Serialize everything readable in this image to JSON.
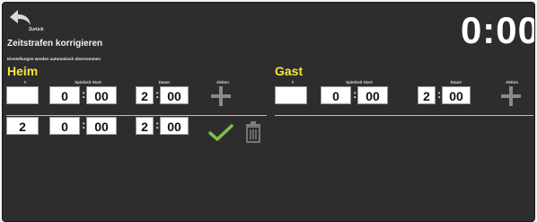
{
  "header": {
    "back_label": "Zurück",
    "title": "Zeitstrafen korrigieren",
    "subtitle": "Einstellungen werden automatisch übernommen",
    "clock": "0:00"
  },
  "home": {
    "name": "Heim",
    "columns": {
      "number": "#",
      "start": "Spielzeit Start",
      "duration": "Dauer",
      "action": "Aktion"
    },
    "new_entry": {
      "number": "",
      "start_min": "0",
      "start_sec": "00",
      "dur_min": "2",
      "dur_sec": "00"
    },
    "penalties": [
      {
        "number": "2",
        "start_min": "0",
        "start_sec": "00",
        "dur_min": "2",
        "dur_sec": "00"
      }
    ]
  },
  "guest": {
    "name": "Gast",
    "columns": {
      "number": "#",
      "start": "Spielzeit Start",
      "duration": "Dauer",
      "action": "Aktion"
    },
    "new_entry": {
      "number": "",
      "start_min": "0",
      "start_sec": "00",
      "dur_min": "2",
      "dur_sec": "00"
    }
  },
  "colors": {
    "accent": "#f5e63a",
    "confirm": "#7dc242",
    "background": "#2d2d2d"
  },
  "icons": {
    "back": "back-arrow-icon",
    "add": "plus-icon",
    "confirm": "checkmark-icon",
    "delete": "trash-icon"
  }
}
